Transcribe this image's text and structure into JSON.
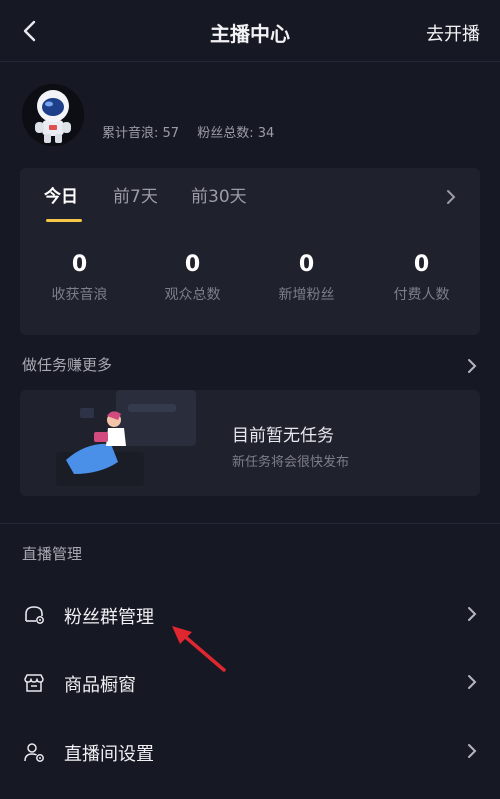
{
  "header": {
    "title": "主播中心",
    "go_live_label": "去开播"
  },
  "profile": {
    "sound_waves_text": "累计音浪: 57",
    "fans_text": "粉丝总数: 34"
  },
  "data_card": {
    "tabs": [
      {
        "label": "今日"
      },
      {
        "label": "前7天"
      },
      {
        "label": "前30天"
      }
    ],
    "active_tab": "今日",
    "metrics": [
      {
        "value": "0",
        "label": "收获音浪"
      },
      {
        "value": "0",
        "label": "观众总数"
      },
      {
        "value": "0",
        "label": "新增粉丝"
      },
      {
        "value": "0",
        "label": "付费人数"
      }
    ]
  },
  "tasks": {
    "section_title": "做任务赚更多",
    "empty_title": "目前暂无任务",
    "empty_subtitle": "新任务将会很快发布"
  },
  "live_management": {
    "section_title": "直播管理",
    "items": [
      {
        "label": "粉丝群管理",
        "icon": "fan-group-icon"
      },
      {
        "label": "商品橱窗",
        "icon": "storefront-icon"
      },
      {
        "label": "直播间设置",
        "icon": "user-settings-icon"
      }
    ]
  },
  "colors": {
    "background": "#161823",
    "card": "#1f212d",
    "accent": "#f5c64a",
    "arrow": "#e0262e"
  }
}
